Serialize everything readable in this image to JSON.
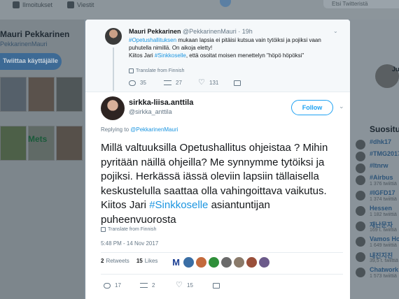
{
  "background": {
    "nav": {
      "notifications": "Ilmoitukset",
      "messages": "Viestit",
      "search_placeholder": "Etsi Twitteristä"
    },
    "profile": {
      "name": "Mauri Pekkarinen",
      "handle": "PekkarinenMauri",
      "tweet_to": "Twiittaa käyttäjälle",
      "photo_text": "Mets"
    },
    "right": {
      "user_label": "Ju",
      "trends_header": "Suositu",
      "trends": [
        {
          "tag": "#dhk17",
          "count": ""
        },
        {
          "tag": "#TMG2017",
          "count": ""
        },
        {
          "tag": "#ltnrw",
          "count": ""
        },
        {
          "tag": "#Airbus",
          "count": "1 376 twiittiä"
        },
        {
          "tag": "#IGFD17",
          "count": "1 374 twiittiä"
        },
        {
          "tag": "Hessen",
          "count": "1 182 twiittiä"
        },
        {
          "tag": "재난문자",
          "count": "169 t. twiittiä"
        },
        {
          "tag": "Vamos Ho",
          "count": "1 649 twiittiä"
        },
        {
          "tag": "내진지진",
          "count": "39,5 t. twiittiä"
        },
        {
          "tag": "Chatwork",
          "count": "1 573 twiittiä"
        }
      ]
    }
  },
  "parent_tweet": {
    "name": "Mauri Pekkarinen",
    "handle": "@PekkarinenMauri",
    "time": "· 19h",
    "hashtag1": "#Opetushallituksen",
    "text1": " mukaan lapsia ei pitäisi kutsua vain tytöiksi ja pojiksi vaan puhutella nimillä. On aikoja eletty!",
    "text2": "Kiitos Jari ",
    "hashtag2": "#Sinkkoselle",
    "text3": ", että osoitat moisen menettelyn \"höpö höpöksi\"",
    "translate": "Translate from Finnish",
    "replies": "35",
    "retweets": "27",
    "likes": "131"
  },
  "tweet": {
    "name": "sirkka-liisa.anttila",
    "handle": "@sirkka_anttila",
    "follow_label": "Follow",
    "replying_prefix": "Replying to ",
    "replying_to": "@PekkarinenMauri",
    "text_main": "Millä valtuuksilla Opetushallitus ohjeistaa ? Mihin pyritään näillä ohjeilla? Me synnymme tytöiksi ja pojiksi. Herkässä iässä oleviin lapsiin tällaisella keskustelulla saattaa olla vahingoittava vaikutus. Kiitos Jari ",
    "text_hashtag": "#Sinkkoselle",
    "text_end": " asiantuntijan puheenvuorosta",
    "translate": "Translate from Finnish",
    "timestamp": "5:48 PM - 14 Nov 2017",
    "retweets_count": "2",
    "retweets_label": "Retweets",
    "likes_count": "15",
    "likes_label": "Likes",
    "liker_initial": "M",
    "replies": "17",
    "retweets": "2",
    "likes": "15"
  },
  "colors": {
    "link": "#1b95e0",
    "accent": "#1da1f2"
  }
}
